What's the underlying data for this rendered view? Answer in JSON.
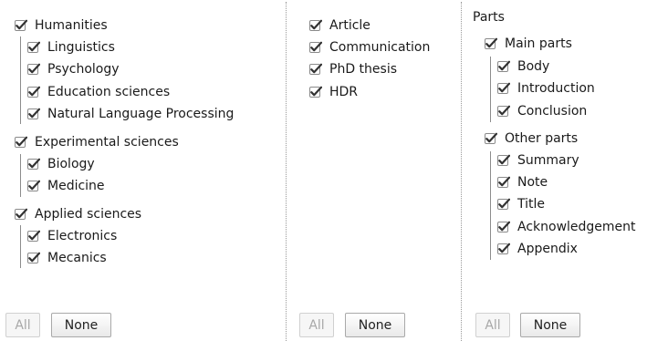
{
  "disciplines": {
    "groups": [
      {
        "label": "Humanities",
        "checked": true,
        "children": [
          {
            "label": "Linguistics",
            "checked": true
          },
          {
            "label": "Psychology",
            "checked": true
          },
          {
            "label": "Education sciences",
            "checked": true
          },
          {
            "label": "Natural Language Processing",
            "checked": true
          }
        ]
      },
      {
        "label": "Experimental sciences",
        "checked": true,
        "children": [
          {
            "label": "Biology",
            "checked": true
          },
          {
            "label": "Medicine",
            "checked": true
          }
        ]
      },
      {
        "label": "Applied sciences",
        "checked": true,
        "children": [
          {
            "label": "Electronics",
            "checked": true
          },
          {
            "label": "Mecanics",
            "checked": true
          }
        ]
      }
    ],
    "all_label": "All",
    "none_label": "None"
  },
  "doc_types": {
    "items": [
      {
        "label": "Article",
        "checked": true
      },
      {
        "label": "Communication",
        "checked": true
      },
      {
        "label": "PhD thesis",
        "checked": true
      },
      {
        "label": "HDR",
        "checked": true
      }
    ],
    "all_label": "All",
    "none_label": "None"
  },
  "parts": {
    "title": "Parts",
    "groups": [
      {
        "label": "Main parts",
        "checked": true,
        "children": [
          {
            "label": "Body",
            "checked": true
          },
          {
            "label": "Introduction",
            "checked": true
          },
          {
            "label": "Conclusion",
            "checked": true
          }
        ]
      },
      {
        "label": "Other parts",
        "checked": true,
        "children": [
          {
            "label": "Summary",
            "checked": true
          },
          {
            "label": "Note",
            "checked": true
          },
          {
            "label": "Title",
            "checked": true
          },
          {
            "label": "Acknowledgement",
            "checked": true
          },
          {
            "label": "Appendix",
            "checked": true
          }
        ]
      }
    ],
    "all_label": "All",
    "none_label": "None"
  },
  "colors": {
    "check": "#333333",
    "box_border": "#8a8a8a"
  }
}
